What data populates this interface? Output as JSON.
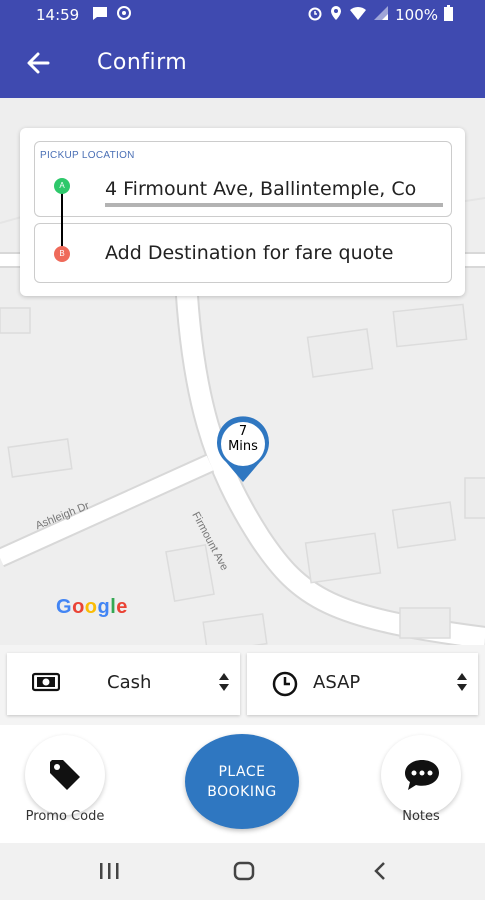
{
  "status_bar": {
    "time": "14:59",
    "battery": "100%"
  },
  "app_bar": {
    "title": "Confirm"
  },
  "locations": {
    "pickup_label": "PICKUP LOCATION",
    "pickup_value": "4 Firmount Ave, Ballintemple, Co",
    "pickup_marker": "A",
    "destination_placeholder": "Add Destination for fare quote",
    "destination_marker": "B"
  },
  "map": {
    "eta_value": "7",
    "eta_unit": "Mins",
    "road_ashleigh": "Ashleigh Dr",
    "road_firmount": "Firmount Ave",
    "google_logo": [
      "G",
      "o",
      "o",
      "g",
      "l",
      "e"
    ]
  },
  "payment": {
    "label": "Cash"
  },
  "pickup_time": {
    "label": "ASAP"
  },
  "actions": {
    "promo_label": "Promo Code",
    "place_line1": "PLACE",
    "place_line2": "BOOKING",
    "notes_label": "Notes"
  },
  "colors": {
    "primary": "#3f4ab0",
    "accent_button": "#2f77c1",
    "marker_a": "#2ec86b",
    "marker_b": "#ef6a5a",
    "pin": "#2f77c1"
  }
}
